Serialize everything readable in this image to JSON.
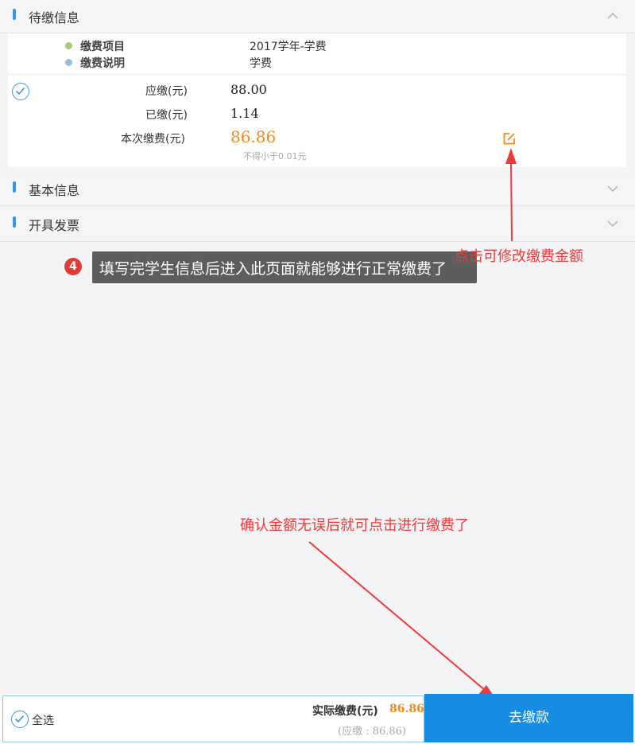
{
  "sections": {
    "pending": {
      "title": "待缴信息"
    },
    "basic": {
      "title": "基本信息"
    },
    "invoice": {
      "title": "开具发票"
    }
  },
  "fee_info": {
    "item_label": "缴费项目",
    "item_value": "2017学年-学费",
    "desc_label": "缴费说明",
    "desc_value": "学费"
  },
  "amounts": {
    "due_label": "应缴(元)",
    "due_value": "88.00",
    "paid_label": "已缴(元)",
    "paid_value": "1.14",
    "current_label": "本次缴费(元)",
    "current_value": "86.86",
    "min_hint": "不得小于0.01元"
  },
  "annotations": {
    "edit_hint": "点击可修改缴费金额",
    "confirm_hint": "确认金额无误后就可点击进行缴费了",
    "step_badge": "4",
    "step_tooltip": "填写完学生信息后进入此页面就能够进行正常缴费了"
  },
  "footer": {
    "select_all": "全选",
    "actual_label": "实际缴费(元)",
    "actual_value": "86.86",
    "due_summary": "(应缴 : 86.86)",
    "pay_button": "去缴款"
  },
  "colors": {
    "accent": "#168de2",
    "amount_orange": "#f08a1c",
    "annotation_red": "#ee3a3a"
  }
}
